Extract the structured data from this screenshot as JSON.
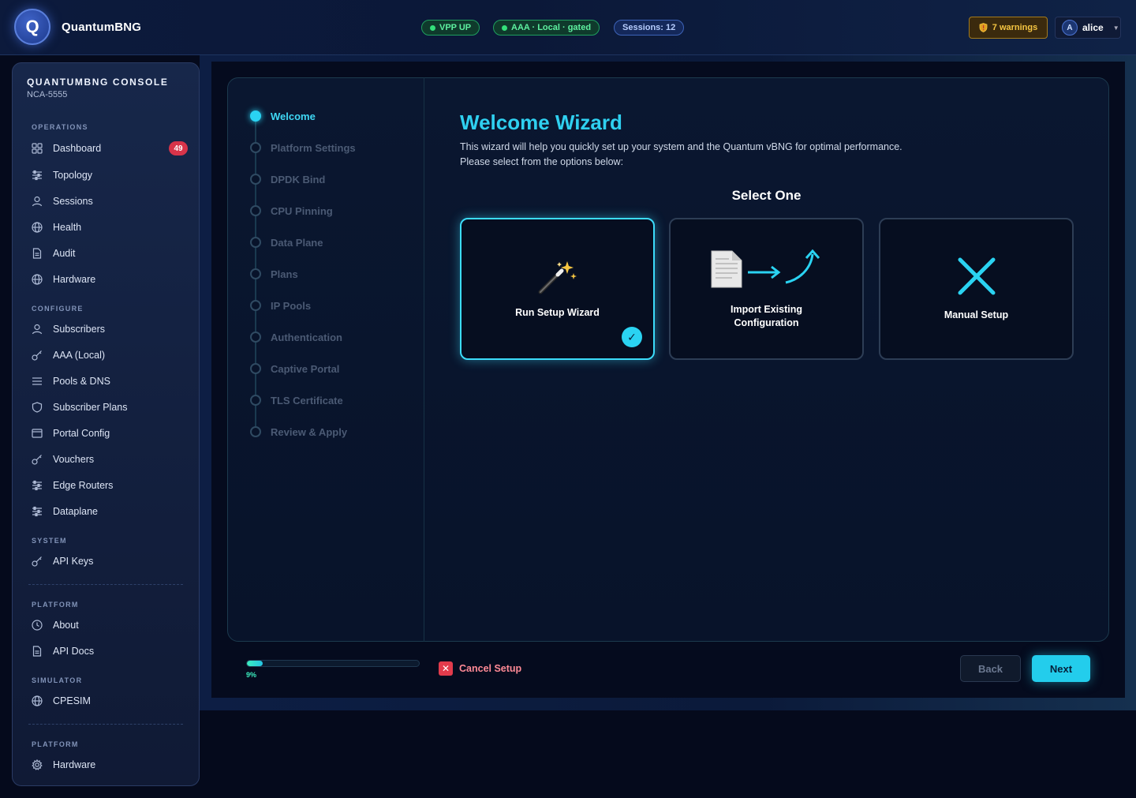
{
  "app": {
    "logo_letter": "Q",
    "name": "QuantumBNG"
  },
  "status": {
    "vpp": "VPP UP",
    "aaa": "AAA · Local · gated",
    "sessions": "Sessions: 12",
    "warnings": "7 warnings",
    "user_initial": "A",
    "user_name": "alice"
  },
  "sidebar": {
    "title": "QUANTUMBNG CONSOLE",
    "subtitle": "NCA-5555",
    "sections": [
      {
        "label": "OPERATIONS"
      },
      {
        "label": "CONFIGURE"
      },
      {
        "label": "SYSTEM"
      },
      {
        "label": "PLATFORM"
      },
      {
        "label": "SIMULATOR"
      },
      {
        "label": "PLATFORM"
      }
    ],
    "items": [
      {
        "label": "Dashboard",
        "icon": "grid-icon",
        "badge": "49"
      },
      {
        "label": "Topology",
        "icon": "sliders-icon"
      },
      {
        "label": "Sessions",
        "icon": "user-icon"
      },
      {
        "label": "Health",
        "icon": "globe-icon"
      },
      {
        "label": "Audit",
        "icon": "document-icon"
      },
      {
        "label": "Hardware",
        "icon": "globe-icon"
      },
      {
        "label": "Subscribers",
        "icon": "user-icon"
      },
      {
        "label": "AAA (Local)",
        "icon": "key-icon"
      },
      {
        "label": "Pools & DNS",
        "icon": "list-icon"
      },
      {
        "label": "Subscriber Plans",
        "icon": "shield-icon"
      },
      {
        "label": "Portal Config",
        "icon": "window-icon"
      },
      {
        "label": "Vouchers",
        "icon": "key-icon"
      },
      {
        "label": "Edge Routers",
        "icon": "sliders-icon"
      },
      {
        "label": "Dataplane",
        "icon": "sliders-icon"
      },
      {
        "label": "API Keys",
        "icon": "key-icon"
      },
      {
        "label": "About",
        "icon": "clock-icon"
      },
      {
        "label": "API Docs",
        "icon": "document-icon"
      },
      {
        "label": "CPESIM",
        "icon": "globe-icon"
      },
      {
        "label": "Hardware",
        "icon": "gear-icon"
      }
    ]
  },
  "wizard": {
    "steps": [
      "Welcome",
      "Platform Settings",
      "DPDK Bind",
      "CPU Pinning",
      "Data Plane",
      "Plans",
      "IP Pools",
      "Authentication",
      "Captive Portal",
      "TLS Certificate",
      "Review & Apply"
    ],
    "active_step": 0,
    "title": "Welcome Wizard",
    "description_line1": "This wizard will help you quickly set up your system and the Quantum vBNG for optimal performance.",
    "description_line2": "Please select from the options below:",
    "select_heading": "Select One",
    "options": [
      {
        "label": "Run Setup Wizard",
        "icon": "magic-wand-icon",
        "selected": true
      },
      {
        "label": "Import Existing Configuration",
        "icon": "import-document-icon",
        "selected": false
      },
      {
        "label": "Manual Setup",
        "icon": "cross-icon",
        "selected": false
      }
    ],
    "progress_percent": 9,
    "progress_label": "9%",
    "cancel_label": "Cancel Setup",
    "back_label": "Back",
    "next_label": "Next"
  },
  "colors": {
    "accent": "#2ad3f2",
    "danger": "#e23b4c",
    "warning": "#f5c542",
    "ok": "#33e07a"
  }
}
